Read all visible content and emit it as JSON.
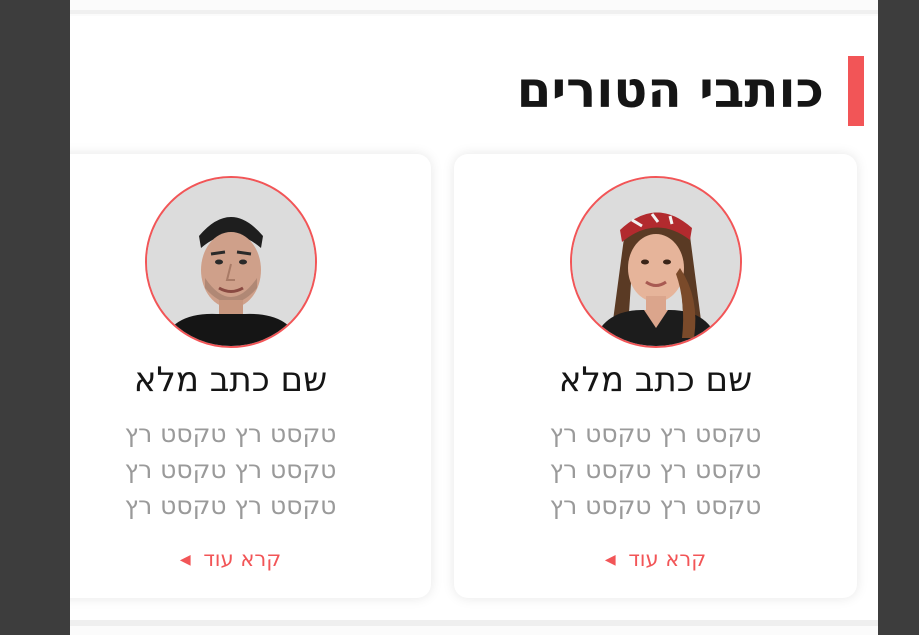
{
  "section": {
    "title": "כותבי הטורים",
    "accent_color": "#f25557"
  },
  "columnists": [
    {
      "name": "שם כתב מלא",
      "bio_lines": [
        "טקסט רץ טקסט רץ",
        "טקסט רץ טקסט רץ",
        "טקסט רץ טקסט רץ"
      ],
      "read_more": "קרא עוד",
      "photo": "woman-with-headscarf"
    },
    {
      "name": "שם כתב מלא",
      "bio_lines": [
        "טקסט רץ טקסט רץ",
        "טקסט רץ טקסט רץ",
        "טקסט רץ טקסט רץ"
      ],
      "read_more": "קרא עוד",
      "photo": "man-short-hair"
    }
  ],
  "icons": {
    "read_more_arrow": "chevron-left-icon"
  }
}
